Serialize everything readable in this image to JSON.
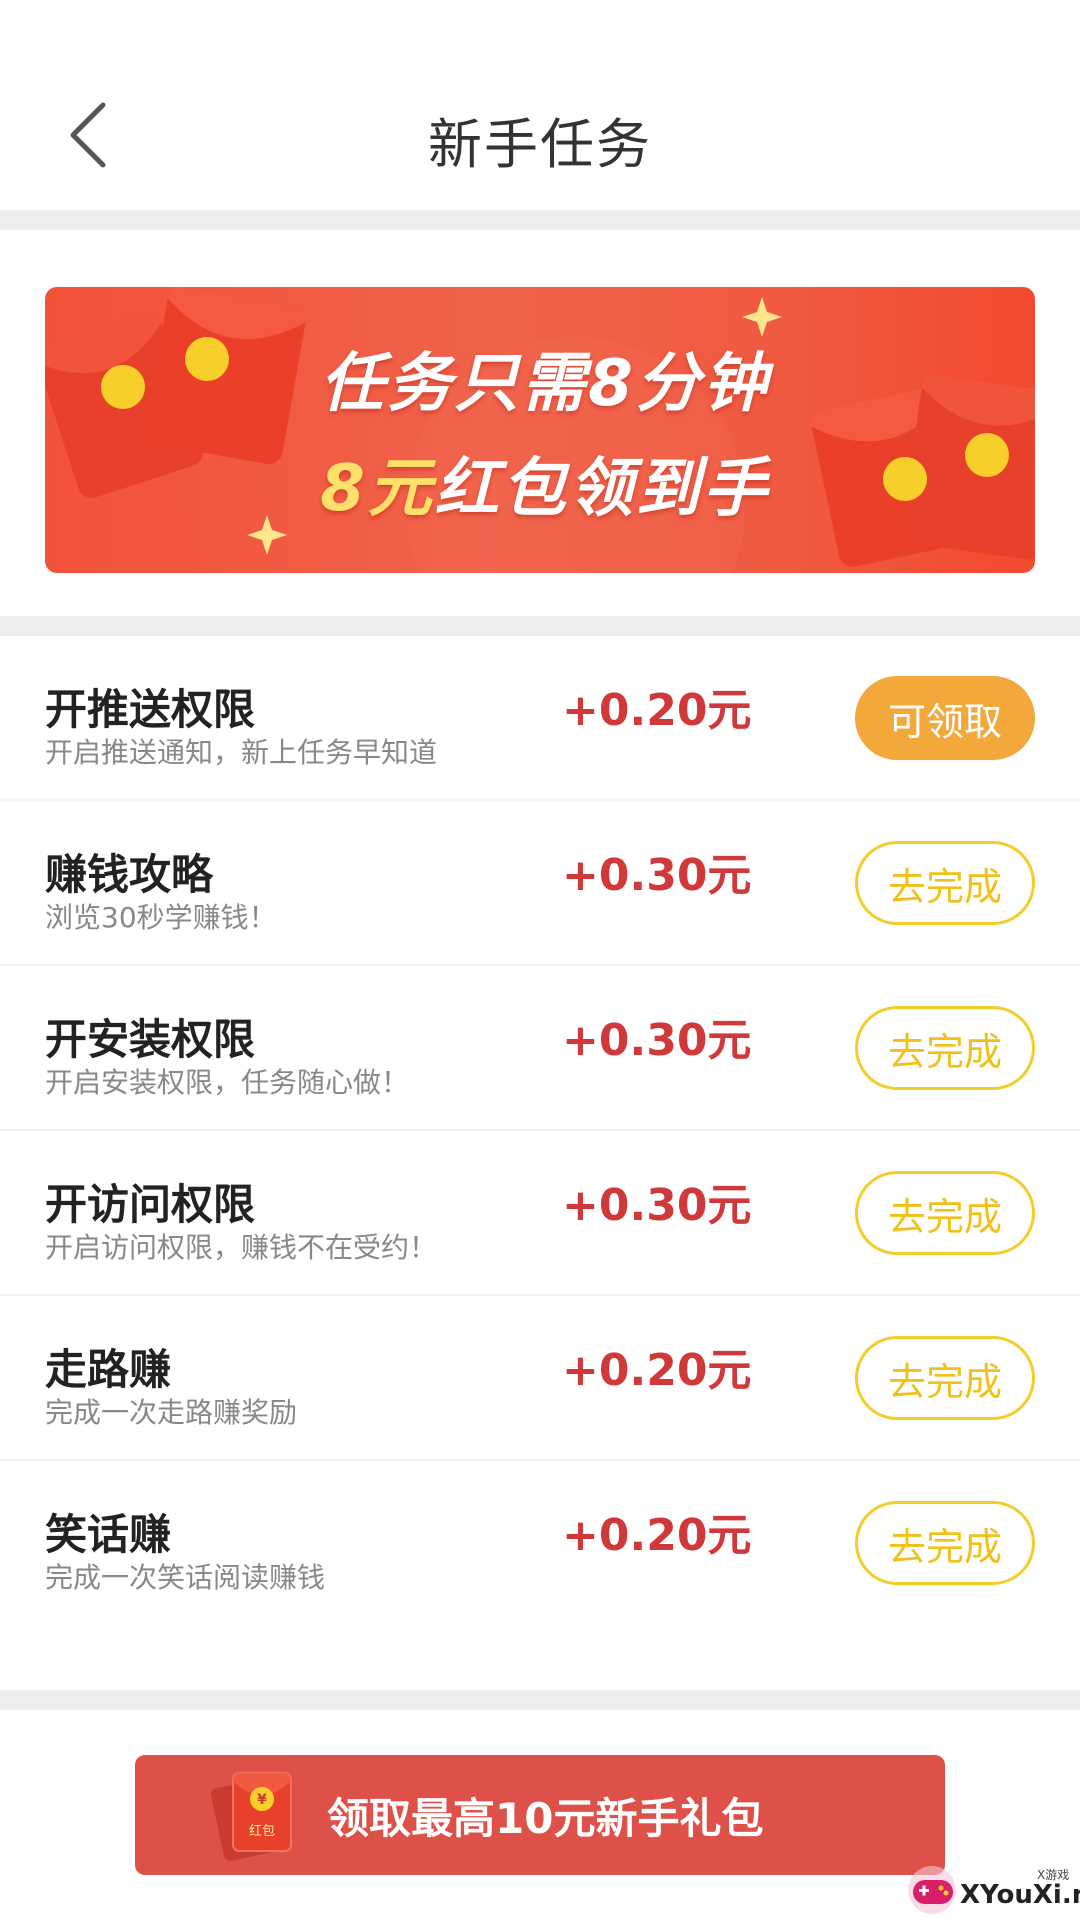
{
  "header": {
    "title": "新手任务"
  },
  "banner": {
    "line1": "任务只需8分钟",
    "line2_highlight": "8元",
    "line2_rest": "红包领到手"
  },
  "tasks": [
    {
      "title": "开推送权限",
      "desc": "开启推送通知，新上任务早知道",
      "reward": "+0.20元",
      "button": "可领取",
      "status": "claim"
    },
    {
      "title": "赚钱攻略",
      "desc": "浏览30秒学赚钱！",
      "reward": "+0.30元",
      "button": "去完成",
      "status": "todo"
    },
    {
      "title": "开安装权限",
      "desc": "开启安装权限，任务随心做！",
      "reward": "+0.30元",
      "button": "去完成",
      "status": "todo"
    },
    {
      "title": "开访问权限",
      "desc": "开启访问权限，赚钱不在受约！",
      "reward": "+0.30元",
      "button": "去完成",
      "status": "todo"
    },
    {
      "title": "走路赚",
      "desc": "完成一次走路赚奖励",
      "reward": "+0.20元",
      "button": "去完成",
      "status": "todo"
    },
    {
      "title": "笑话赚",
      "desc": "完成一次笑话阅读赚钱",
      "reward": "+0.20元",
      "button": "去完成",
      "status": "todo"
    }
  ],
  "bottom": {
    "button_label": "领取最高10元新手礼包",
    "envelope_text": "红包",
    "envelope_symbol": "¥"
  },
  "watermark": {
    "text": "XYouXi.net",
    "small": "X游戏"
  },
  "colors": {
    "reward": "#d0393a",
    "claim_button": "#f2a83b",
    "todo_button": "#f2cd2b",
    "bottom_button": "#dd5149"
  }
}
